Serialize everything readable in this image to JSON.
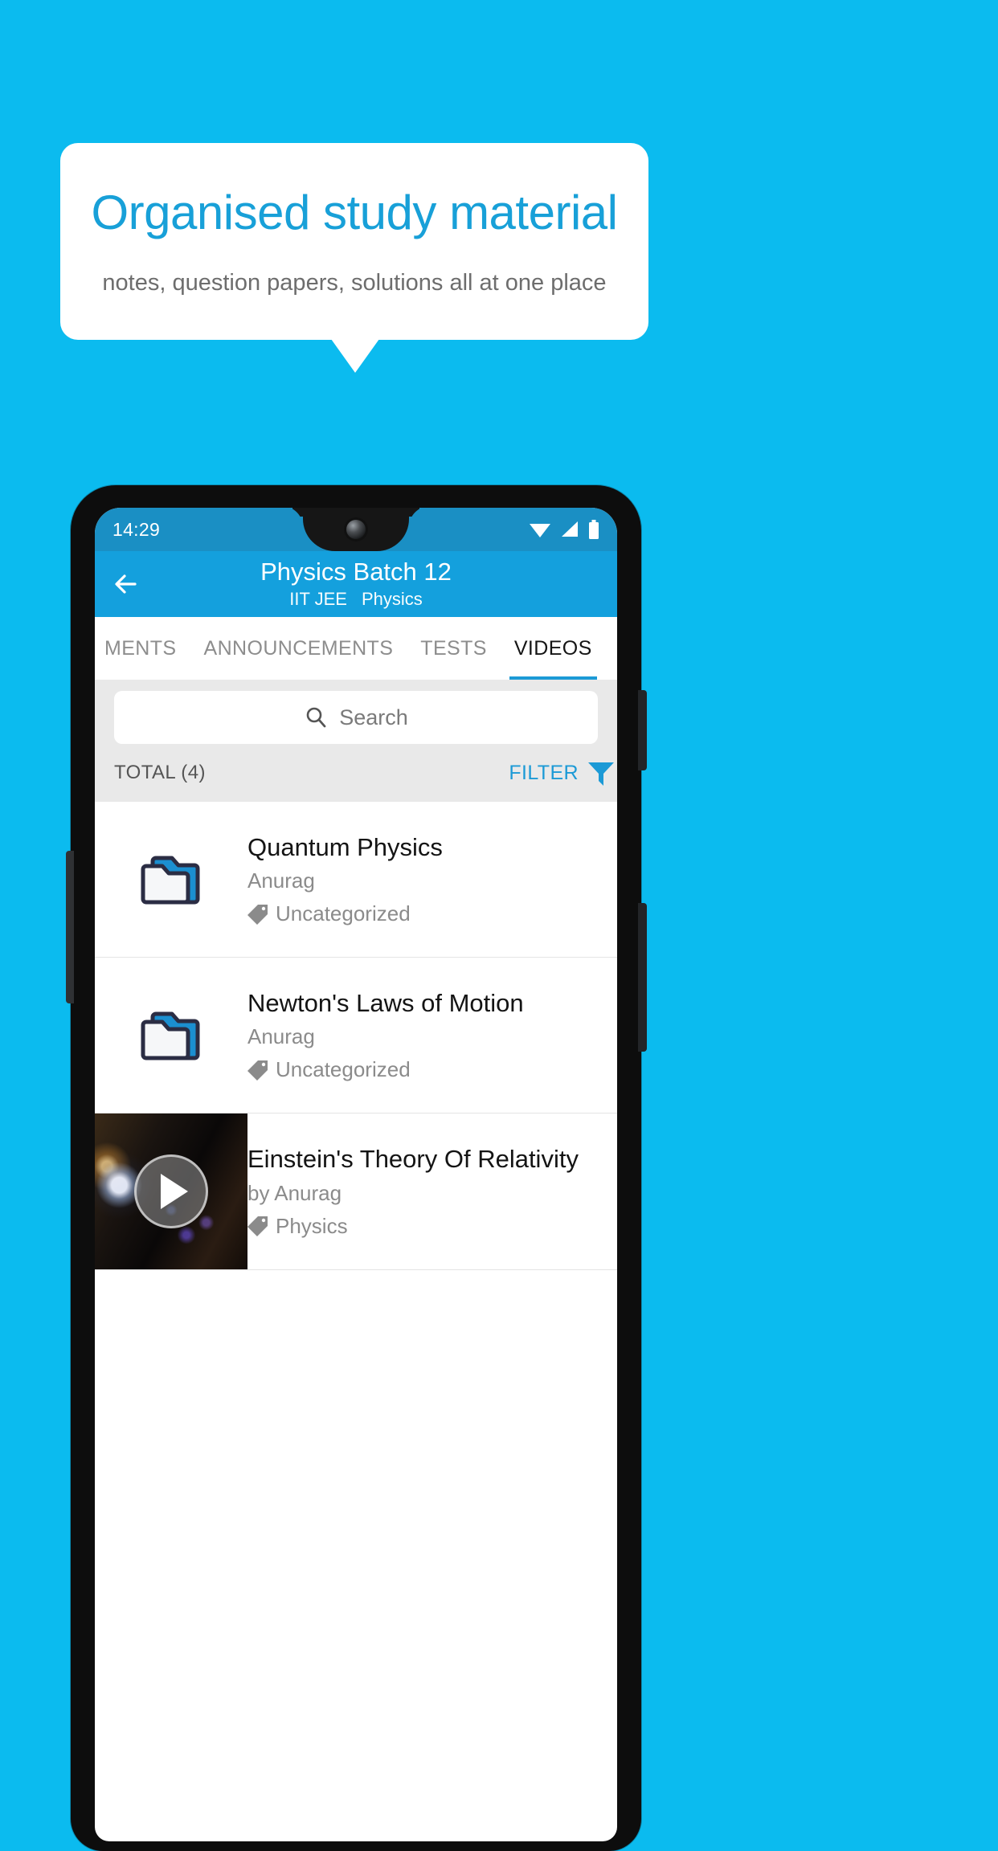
{
  "promo": {
    "title": "Organised study material",
    "subtitle": "notes, question papers, solutions all at one place",
    "title_color": "#18a0d8",
    "background_color": "#0bbbef"
  },
  "phone": {
    "statusbar": {
      "time": "14:29",
      "icons": [
        "wifi-icon",
        "signal-icon",
        "battery-icon"
      ]
    },
    "appbar": {
      "back_icon": "back-arrow-icon",
      "title": "Physics Batch 12",
      "exam": "IIT JEE",
      "subject": "Physics",
      "background_color": "#14a0dd"
    },
    "tabs": [
      {
        "label": "MENTS",
        "active": false
      },
      {
        "label": "ANNOUNCEMENTS",
        "active": false
      },
      {
        "label": "TESTS",
        "active": false
      },
      {
        "label": "VIDEOS",
        "active": true
      }
    ],
    "search": {
      "placeholder": "Search",
      "value": "",
      "icon": "search-icon"
    },
    "meta": {
      "total_label": "TOTAL (4)",
      "filter_label": "FILTER",
      "filter_icon": "filter-funnel-icon",
      "accent_color": "#1c9ad6"
    },
    "list": [
      {
        "kind": "folder",
        "icon": "folder-icon",
        "title": "Quantum Physics",
        "author": "Anurag",
        "tag": "Uncategorized",
        "tag_icon": "tag-icon"
      },
      {
        "kind": "folder",
        "icon": "folder-icon",
        "title": "Newton's Laws of Motion",
        "author": "Anurag",
        "tag": "Uncategorized",
        "tag_icon": "tag-icon"
      },
      {
        "kind": "video",
        "icon": "video-thumbnail",
        "play_icon": "play-icon",
        "title": "Einstein's Theory Of Relativity",
        "author": "by Anurag",
        "tag": "Physics",
        "tag_icon": "tag-icon"
      }
    ]
  }
}
